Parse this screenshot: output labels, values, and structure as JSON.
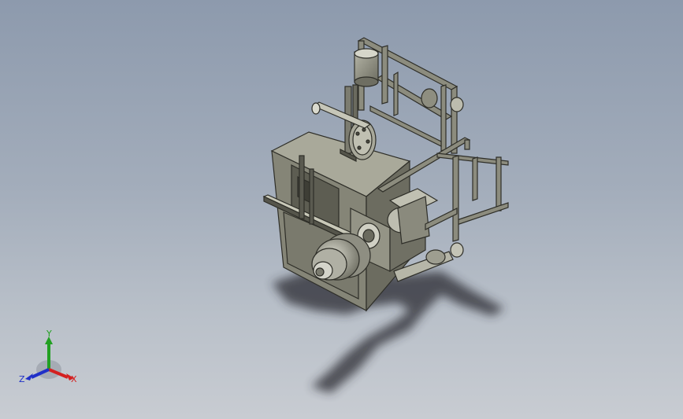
{
  "triad": {
    "x_label": "X",
    "y_label": "Y",
    "z_label": "Z",
    "x_color": "#d42020",
    "y_color": "#22a022",
    "z_color": "#2030c8"
  },
  "scene": {
    "background_top": "#8d9aad",
    "background_bottom": "#c8ccd2",
    "part_color": "#8a8a7c",
    "part_dark": "#4a4a40",
    "shadow_color": "#2a2c30"
  }
}
